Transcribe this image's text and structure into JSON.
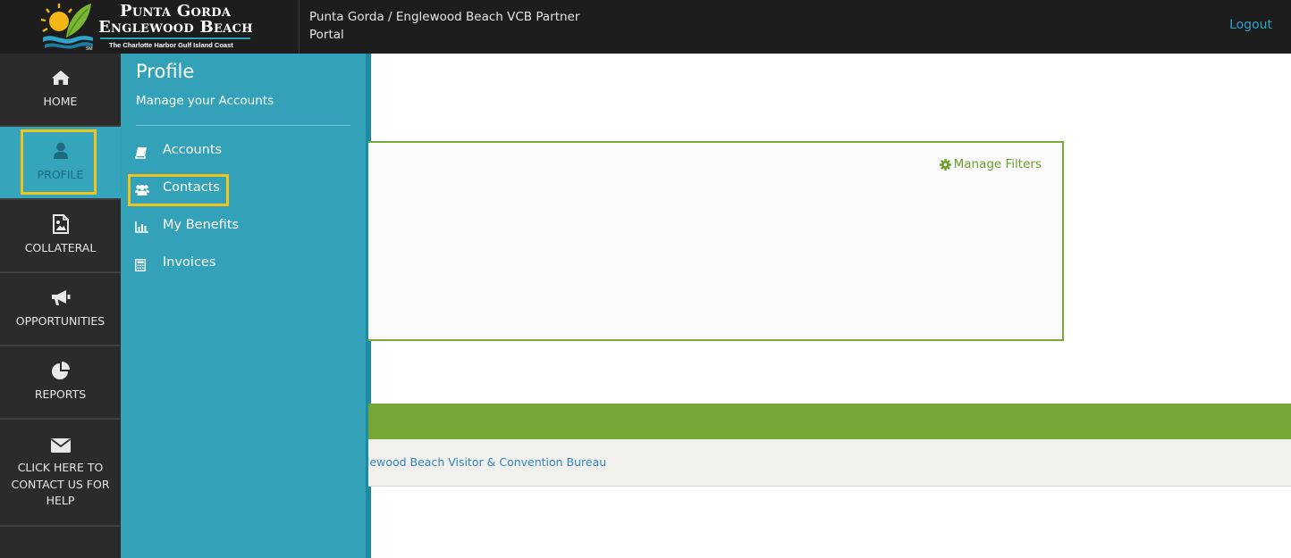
{
  "header": {
    "logo": {
      "line1": "Punta Gorda",
      "line2": "Englewood Beach",
      "tagline": "The Charlotte Harbor Gulf Island Coast",
      "trademark": "SM"
    },
    "portal_title": "Punta Gorda / Englewood Beach VCB Partner Portal",
    "logout_label": "Logout"
  },
  "sidebar": {
    "items": [
      {
        "label": "HOME",
        "icon": "home-icon",
        "active": false
      },
      {
        "label": "PROFILE",
        "icon": "user-icon",
        "active": true
      },
      {
        "label": "COLLATERAL",
        "icon": "image-file-icon",
        "active": false
      },
      {
        "label": "OPPORTUNITIES",
        "icon": "megaphone-icon",
        "active": false
      },
      {
        "label": "REPORTS",
        "icon": "pie-chart-icon",
        "active": false
      },
      {
        "label": "CLICK HERE TO CONTACT US FOR HELP",
        "icon": "envelope-icon",
        "active": false
      }
    ]
  },
  "flyout": {
    "title": "Profile",
    "subtitle": "Manage your Accounts",
    "items": [
      {
        "label": "Accounts",
        "icon": "book-icon"
      },
      {
        "label": "Contacts",
        "icon": "users-icon"
      },
      {
        "label": "My Benefits",
        "icon": "bar-chart-icon"
      },
      {
        "label": "Invoices",
        "icon": "calculator-icon"
      }
    ]
  },
  "main": {
    "manage_filters_label": "Manage Filters",
    "footer_link": "glewood Beach Visitor & Convention Bureau"
  },
  "colors": {
    "header_bg": "#1d1d1d",
    "sidebar_bg": "#2b2b2b",
    "accent_teal": "#33a2b9",
    "accent_green": "#76a636",
    "highlight": "#f2c41b",
    "link_blue": "#2f86b8"
  }
}
